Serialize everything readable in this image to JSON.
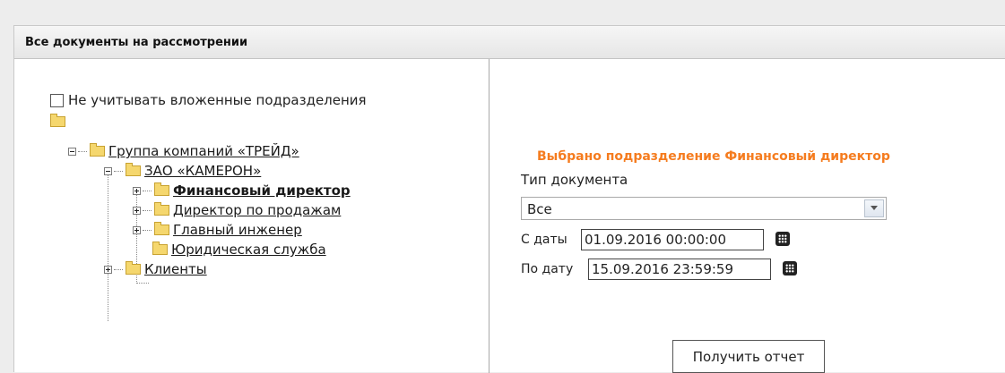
{
  "panel": {
    "title": "Все документы на рассмотрении"
  },
  "tree": {
    "checkbox_label": "Не учитывать вложенные подразделения",
    "nodes": {
      "group": "Группа компаний «ТРЕЙД»",
      "cameron": "ЗАО «КАМЕРОН»",
      "finance": "Финансовый директор",
      "sales": "Директор по продажам",
      "engineer": "Главный инженер",
      "legal": "Юридическая служба",
      "clients": "Клиенты"
    }
  },
  "form": {
    "selected_title": "Выбрано подразделение Финансовый директор",
    "doc_type_label": "Тип документа",
    "doc_type_value": "Все",
    "from_label": "С даты",
    "from_value": "01.09.2016 00:00:00",
    "to_label": "По дату",
    "to_value": "15.09.2016 23:59:59",
    "submit_label": "Получить отчет"
  },
  "icons": [
    "folder-icon",
    "calendar-icon",
    "chevron-down-icon",
    "expand-icon",
    "collapse-icon"
  ],
  "colors": {
    "accent": "#f57c1f",
    "folder": "#f5d76e"
  }
}
